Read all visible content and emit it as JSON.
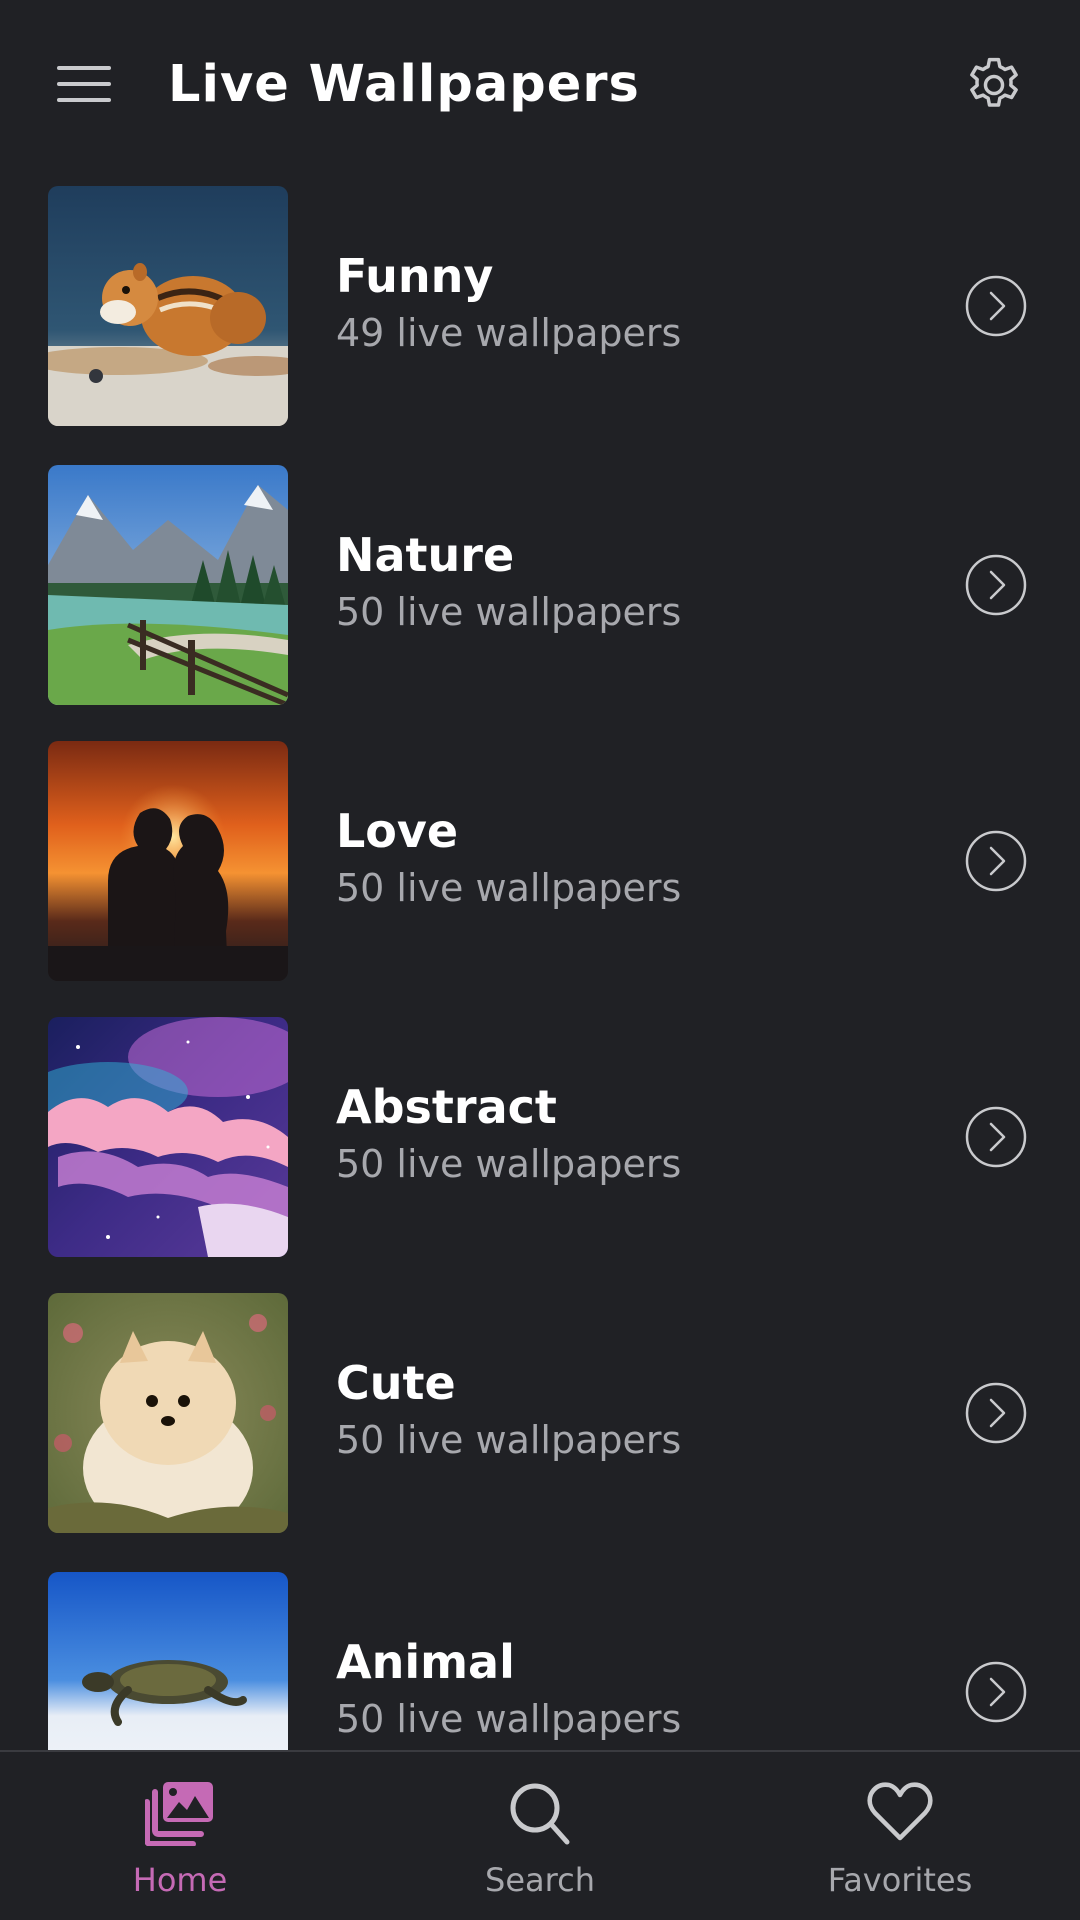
{
  "header": {
    "title": "Live Wallpapers",
    "menu_icon": "hamburger-menu-icon",
    "settings_icon": "gear-icon"
  },
  "categories": [
    {
      "title": "Funny",
      "count": "49 live wallpapers",
      "thumbnail": "chipmunk-photo"
    },
    {
      "title": "Nature",
      "count": "50 live wallpapers",
      "thumbnail": "mountain-lake-photo"
    },
    {
      "title": "Love",
      "count": "50 live wallpapers",
      "thumbnail": "couple-sunset-photo"
    },
    {
      "title": "Abstract",
      "count": "50 live wallpapers",
      "thumbnail": "galaxy-clouds-photo"
    },
    {
      "title": "Cute",
      "count": "50 live wallpapers",
      "thumbnail": "pomeranian-puppy-photo"
    },
    {
      "title": "Animal",
      "count": "50 live wallpapers",
      "thumbnail": "sea-turtle-photo"
    }
  ],
  "bottom_nav": {
    "items": [
      {
        "label": "Home",
        "icon": "gallery-icon",
        "active": true
      },
      {
        "label": "Search",
        "icon": "search-icon",
        "active": false
      },
      {
        "label": "Favorites",
        "icon": "heart-icon",
        "active": false
      }
    ]
  },
  "colors": {
    "background": "#202125",
    "accent": "#c56ab5",
    "secondary_text": "#a7a8ad"
  }
}
